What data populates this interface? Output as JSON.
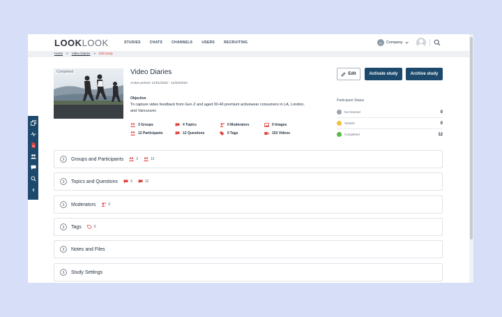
{
  "header": {
    "logo_bold": "LOOK",
    "logo_light": "LOOK",
    "nav": [
      "STUDIES",
      "CHATS",
      "CHANNELS",
      "USERS",
      "RECRUITING"
    ],
    "company_initials": "LL",
    "company_label": "Company"
  },
  "breadcrumb": {
    "home": "Home",
    "sep": ">",
    "parent": "Video Diaries",
    "current": "Edit study"
  },
  "study": {
    "badge": "Completed",
    "title": "Video Diaries",
    "active_period": "Active period: 11/01/2022 - 11/04/2022",
    "objective_heading": "Objective",
    "objective_text": "To capture video feedback from Gen Z and aged 30-40 premium activewear consumers in LA, London, and Vancouver.",
    "stats": {
      "groups": "3 Groups",
      "topics": "4 Topics",
      "moderators": "0 Moderators",
      "images": "0 Images",
      "participants": "12 Participants",
      "questions": "12 Questions",
      "tags": "0 Tags",
      "videos": "153 Videos"
    }
  },
  "actions": {
    "edit": "Edit",
    "activate": "Activate study",
    "archive": "Archive study"
  },
  "participant_status": {
    "heading": "Participant Status",
    "rows": [
      {
        "label": "Not Started",
        "count": "0",
        "color": "#9aa3ad"
      },
      {
        "label": "Started",
        "count": "0",
        "color": "#f0c23b"
      },
      {
        "label": "Completed",
        "count": "12",
        "color": "#58b947"
      }
    ]
  },
  "sections": [
    {
      "title": "Groups and Participants",
      "counts": [
        "3",
        "12"
      ]
    },
    {
      "title": "Topics and Questions",
      "counts": [
        "4",
        "12"
      ]
    },
    {
      "title": "Moderators",
      "counts": [
        "0"
      ]
    },
    {
      "title": "Tags",
      "counts": [
        "0"
      ]
    },
    {
      "title": "Notes and Files",
      "counts": []
    },
    {
      "title": "Study Settings",
      "counts": []
    }
  ],
  "colors": {
    "primary": "#1d4a6c",
    "accent_red": "#e0413c",
    "background": "#d6def8"
  }
}
